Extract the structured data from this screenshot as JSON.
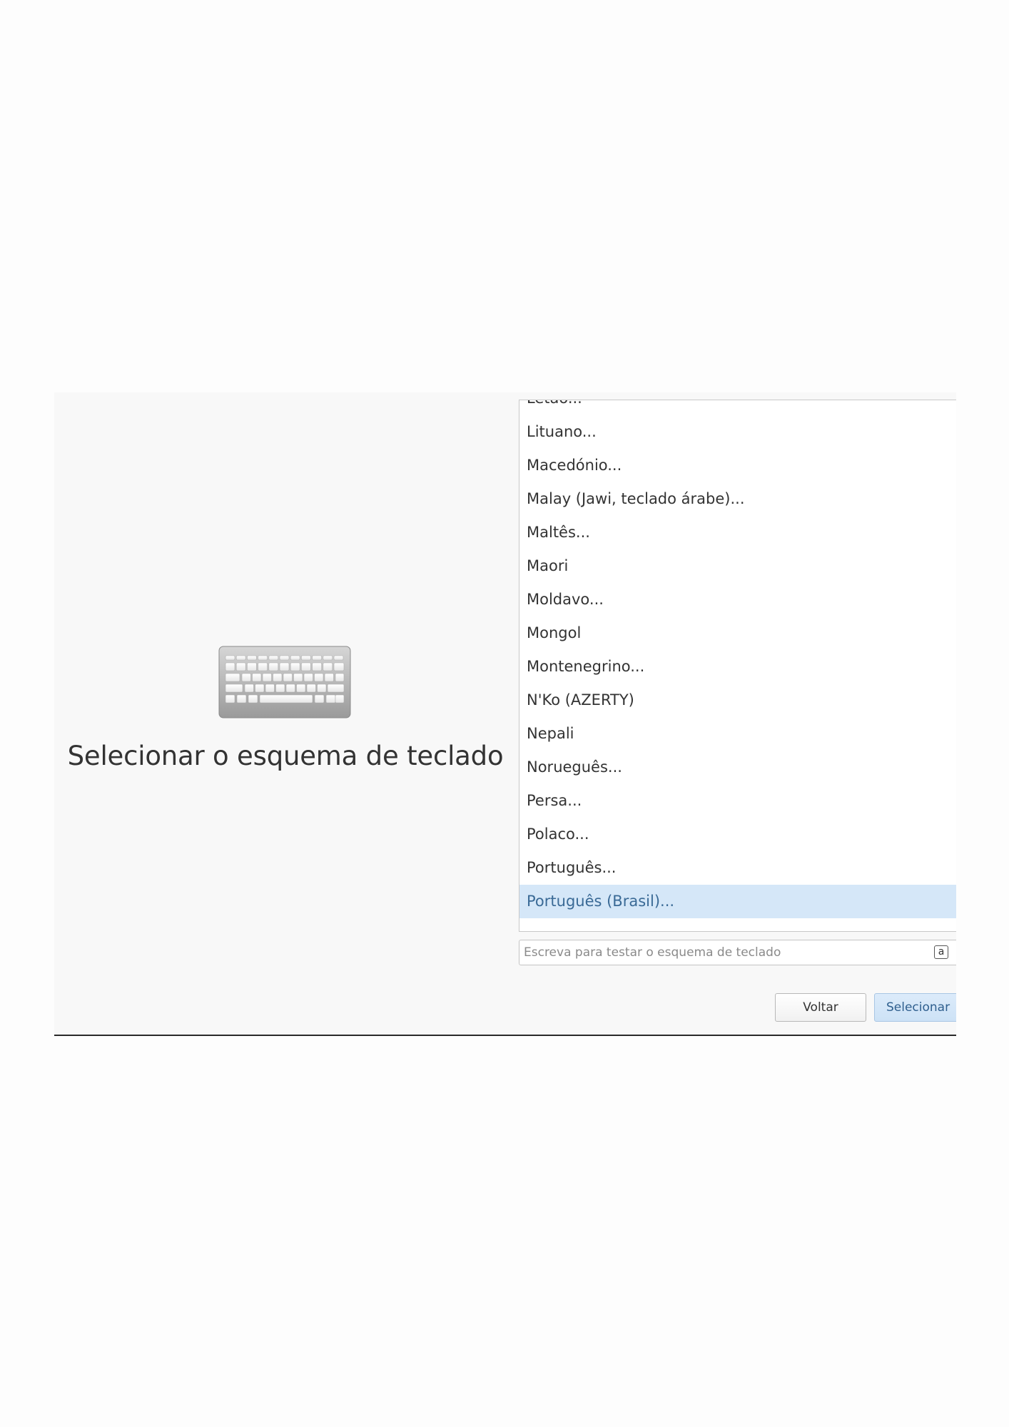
{
  "header": {
    "title": "Selecionar o esquema de teclado",
    "icon": "keyboard-icon"
  },
  "layout_list": {
    "items": [
      {
        "label": "Letão..."
      },
      {
        "label": "Lituano..."
      },
      {
        "label": "Macedónio..."
      },
      {
        "label": "Malay (Jawi, teclado árabe)..."
      },
      {
        "label": "Maltês..."
      },
      {
        "label": "Maori"
      },
      {
        "label": "Moldavo..."
      },
      {
        "label": "Mongol"
      },
      {
        "label": "Montenegrino..."
      },
      {
        "label": "N'Ko (AZERTY)"
      },
      {
        "label": "Nepali"
      },
      {
        "label": "Norueguês..."
      },
      {
        "label": "Persa..."
      },
      {
        "label": "Polaco..."
      },
      {
        "label": "Português..."
      },
      {
        "label": "Português (Brasil)..."
      }
    ],
    "selected": "Português (Brasil)..."
  },
  "test_input": {
    "placeholder": "Escreva para testar o esquema de teclado",
    "value": "",
    "layout_indicator": "a"
  },
  "buttons": {
    "back_label": "Voltar",
    "select_label": "Selecionar"
  },
  "colors": {
    "selected_row_bg": "#d5e7f8",
    "selected_row_text": "#3a6a96",
    "primary_button_bg": "#d4e6f8",
    "dialog_bg": "#f8f8f8"
  }
}
